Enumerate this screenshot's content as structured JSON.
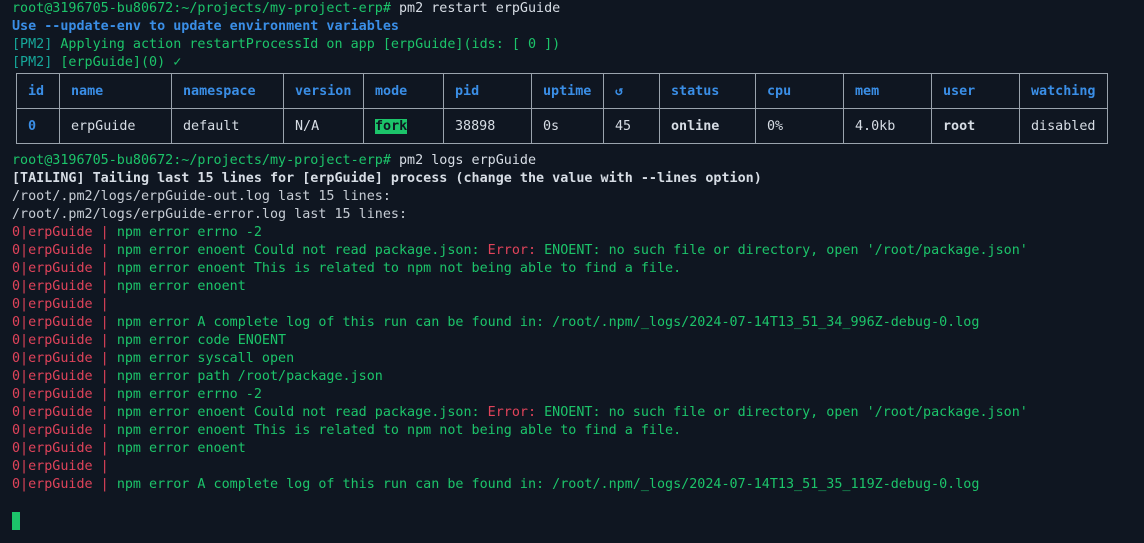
{
  "restart": {
    "prompt": "root@3196705-bu80672:~/projects/my-project-erp#",
    "command": "pm2 restart erpGuide",
    "hint": "Use --update-env to update environment variables",
    "action_tag": "[PM2]",
    "action_text": "Applying action restartProcessId on app [erpGuide](ids: [ 0 ])",
    "done_tag": "[PM2]",
    "done_text": "[erpGuide](0) ✓"
  },
  "table": {
    "headers": [
      "id",
      "name",
      "namespace",
      "version",
      "mode",
      "pid",
      "uptime",
      "↺",
      "status",
      "cpu",
      "mem",
      "user",
      "watching"
    ],
    "row": {
      "id": "0",
      "name": "erpGuide",
      "namespace": "default",
      "version": "N/A",
      "mode": "fork",
      "pid": "38898",
      "uptime": "0s",
      "restarts": "45",
      "status": "online",
      "cpu": "0%",
      "mem": "4.0kb",
      "user": "root",
      "watching": "disabled"
    }
  },
  "logs": {
    "prompt": "root@3196705-bu80672:~/projects/my-project-erp#",
    "command": "pm2 logs erpGuide",
    "tailing": "[TAILING] Tailing last 15 lines for [erpGuide] process (change the value with --lines option)",
    "out_log": "/root/.pm2/logs/erpGuide-out.log last 15 lines:",
    "err_log": "/root/.pm2/logs/erpGuide-error.log last 15 lines:",
    "prefix": "0|erpGuide |",
    "lines": [
      {
        "a": "npm error errno -2",
        "err": "",
        "b": ""
      },
      {
        "a": "npm error enoent Could not read package.json: ",
        "err": "Error:",
        "b": " ENOENT: no such file or directory, open '/root/package.json'"
      },
      {
        "a": "npm error enoent This is related to npm not being able to find a file.",
        "err": "",
        "b": ""
      },
      {
        "a": "npm error enoent",
        "err": "",
        "b": ""
      },
      {
        "a": "",
        "err": "",
        "b": ""
      },
      {
        "a": "npm error A complete log of this run can be found in: /root/.npm/_logs/2024-07-14T13_51_34_996Z-debug-0.log",
        "err": "",
        "b": ""
      },
      {
        "a": "npm error code ENOENT",
        "err": "",
        "b": ""
      },
      {
        "a": "npm error syscall open",
        "err": "",
        "b": ""
      },
      {
        "a": "npm error path /root/package.json",
        "err": "",
        "b": ""
      },
      {
        "a": "npm error errno -2",
        "err": "",
        "b": ""
      },
      {
        "a": "npm error enoent Could not read package.json: ",
        "err": "Error:",
        "b": " ENOENT: no such file or directory, open '/root/package.json'"
      },
      {
        "a": "npm error enoent This is related to npm not being able to find a file.",
        "err": "",
        "b": ""
      },
      {
        "a": "npm error enoent",
        "err": "",
        "b": ""
      },
      {
        "a": "",
        "err": "",
        "b": ""
      },
      {
        "a": "npm error A complete log of this run can be found in: /root/.npm/_logs/2024-07-14T13_51_35_119Z-debug-0.log",
        "err": "",
        "b": ""
      }
    ]
  },
  "colors": {
    "background": "#0f1621",
    "prompt_green": "#1cc46a",
    "header_blue": "#3a8ee6",
    "pm2_teal": "#16a79a",
    "error_red": "#e0435a"
  }
}
